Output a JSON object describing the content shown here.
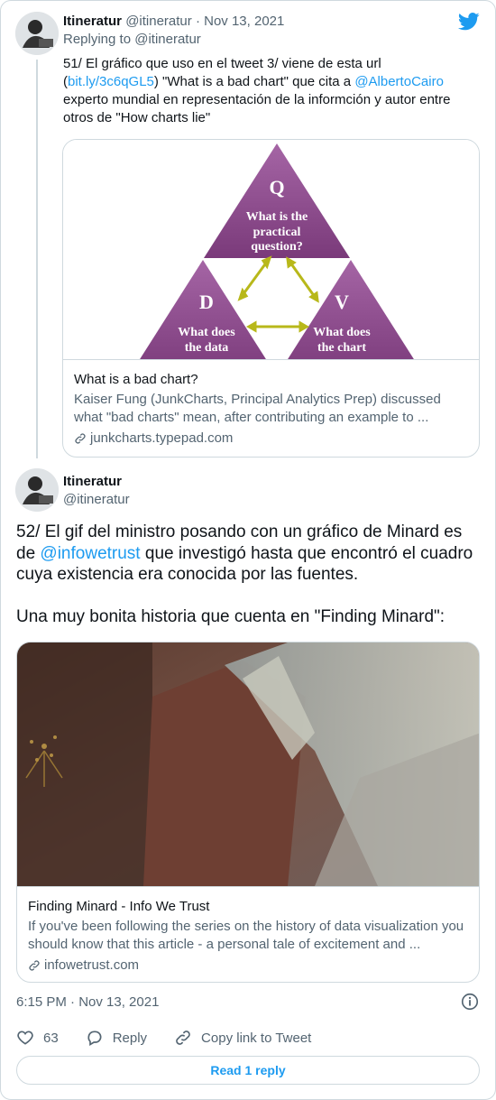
{
  "reply_tweet": {
    "author_name": "Itineratur",
    "author_handle": "@itineratur",
    "separator": "·",
    "date": "Nov 13, 2021",
    "replying_prefix": "Replying to",
    "replying_handle": "@itineratur",
    "text": {
      "part1": "51/ El gráfico que uso en el tweet 3/ viene de esta url (",
      "link1": "bit.ly/3c6qGL5",
      "part2": ") \"What is a bad chart\" que cita a ",
      "link2": "@AlbertoCairo",
      "part3": " experto mundial en representación de la informción y autor entre otros de \"How charts lie\""
    },
    "card": {
      "image": {
        "top_letter": "Q",
        "top_text_1": "What is the",
        "top_text_2": "practical",
        "top_text_3": "question?",
        "left_letter": "D",
        "left_text_1": "What does",
        "left_text_2": "the data",
        "right_letter": "V",
        "right_text_1": "What does",
        "right_text_2": "the chart"
      },
      "title": "What is a bad chart?",
      "description": "Kaiser Fung (JunkCharts, Principal Analytics Prep) discussed what \"bad charts\" mean, after contributing an example to ...",
      "domain": "junkcharts.typepad.com"
    }
  },
  "main_tweet": {
    "author_name": "Itineratur",
    "author_handle": "@itineratur",
    "text": {
      "part1": "52/ El gif del ministro posando con un gráfico de Minard es de ",
      "mention": "@infowetrust",
      "part2": " que investigó hasta que encontró el cuadro cuya existencia era conocida por las fuentes.",
      "paragraph2": "Una muy bonita historia que cuenta en \"Finding Minard\":"
    },
    "card": {
      "title": "Finding Minard - Info We Trust",
      "description": "If you've been following the series on the history of data visualization you should know that this article - a personal tale of excitement and ...",
      "domain": "infowetrust.com"
    },
    "timestamp": "6:15 PM · Nov 13, 2021",
    "likes": "63",
    "reply_label": "Reply",
    "copy_label": "Copy link to Tweet",
    "read_replies": "Read 1 reply"
  },
  "colors": {
    "accent": "#1d9bf0",
    "text": "#0f1419",
    "muted": "#536471",
    "border": "#cfd9de",
    "triangle": "#8e4a8e"
  },
  "icons": {
    "brand": "twitter-bird-icon",
    "link": "link-icon",
    "info": "info-icon",
    "like": "heart-icon",
    "reply": "reply-bubble-icon",
    "copy": "copy-link-icon"
  }
}
